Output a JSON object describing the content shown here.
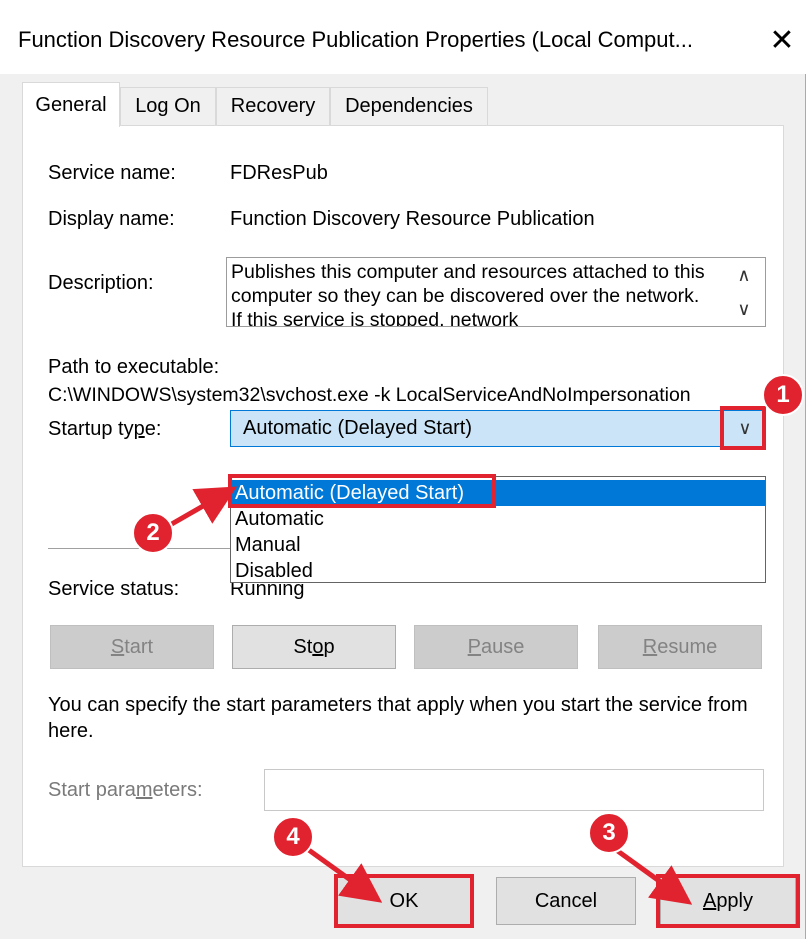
{
  "window": {
    "title": "Function Discovery Resource Publication Properties (Local Comput...",
    "close_glyph": "✕"
  },
  "tabs": [
    {
      "label": "General"
    },
    {
      "label": "Log On"
    },
    {
      "label": "Recovery"
    },
    {
      "label": "Dependencies"
    }
  ],
  "general": {
    "service_name_label": "Service name:",
    "service_name_value": "FDResPub",
    "display_name_label": "Display name:",
    "display_name_value": "Function Discovery Resource Publication",
    "description_label": "Description:",
    "description_value": "Publishes this computer and resources attached to this computer so they can be discovered over the network.  If this service is stopped, network",
    "path_label": "Path to executable:",
    "path_value": "C:\\WINDOWS\\system32\\svchost.exe -k LocalServiceAndNoImpersonation",
    "startup_label_pre": "Startup ty",
    "startup_label_ul": "p",
    "startup_label_post": "e:",
    "startup_selected": "Automatic (Delayed Start)",
    "startup_options": [
      "Automatic (Delayed Start)",
      "Automatic",
      "Manual",
      "Disabled"
    ],
    "status_label": "Service status:",
    "status_value": "Running",
    "buttons": {
      "start_ul": "S",
      "start_rest": "tart",
      "stop_pre": "St",
      "stop_ul": "o",
      "stop_post": "p",
      "pause_ul": "P",
      "pause_rest": "ause",
      "resume_ul": "R",
      "resume_rest": "esume"
    },
    "params_note": "You can specify the start parameters that apply when you start the service from here.",
    "params_label_pre": "Start para",
    "params_label_ul": "m",
    "params_label_post": "eters:",
    "params_value": ""
  },
  "footer": {
    "ok_label": "OK",
    "cancel_label": "Cancel",
    "apply_ul": "A",
    "apply_rest": "pply"
  },
  "annotations": {
    "badges": [
      "1",
      "2",
      "3",
      "4"
    ],
    "color": "#e0232e"
  }
}
